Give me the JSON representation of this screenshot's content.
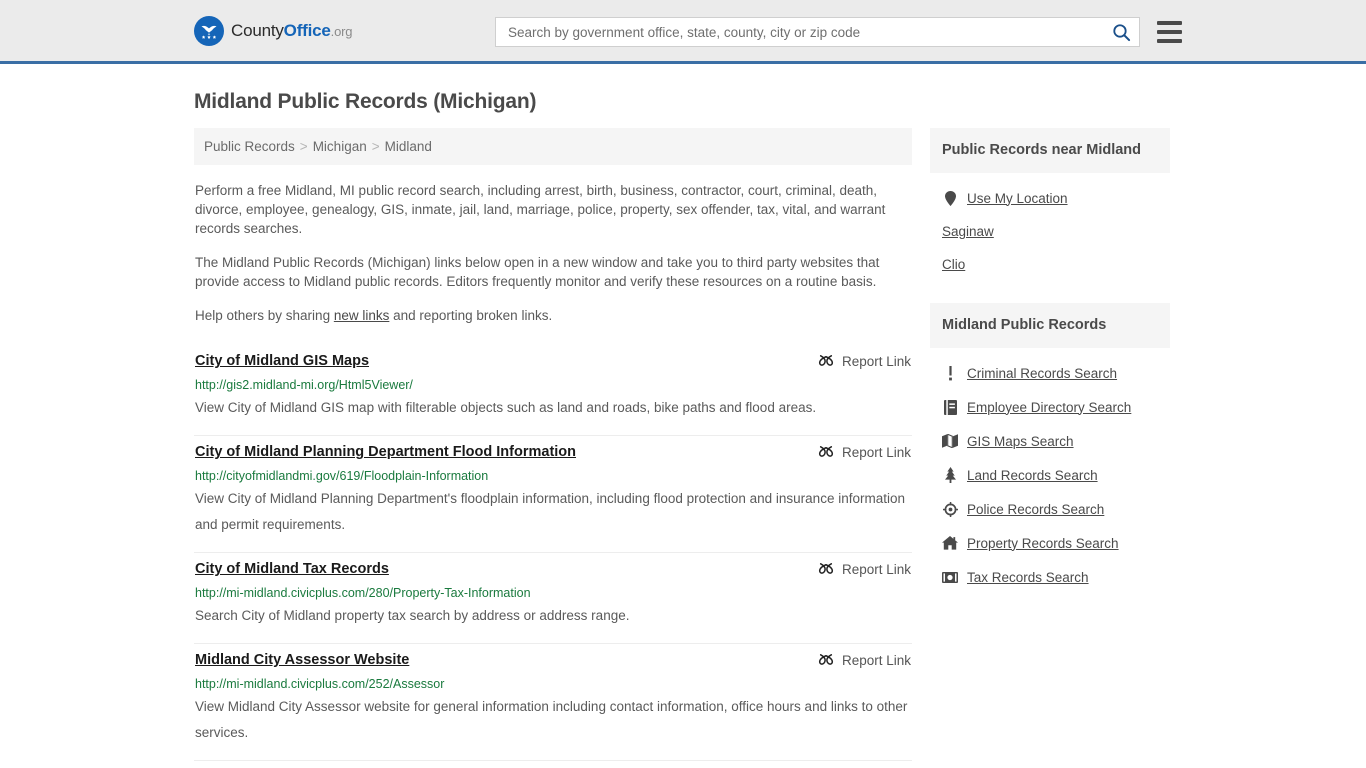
{
  "header": {
    "logo": {
      "part1": "County",
      "part2": "Office",
      "part3": ".org",
      "emblem_color": "#1565b8"
    },
    "search": {
      "placeholder": "Search by government office, state, county, city or zip code",
      "value": ""
    },
    "accent_color": "#3a6ea5",
    "background_color": "#ebebeb"
  },
  "page_title": "Midland Public Records (Michigan)",
  "breadcrumb": {
    "separator": ">",
    "items": [
      {
        "label": "Public Records"
      },
      {
        "label": "Michigan"
      },
      {
        "label": "Midland"
      }
    ]
  },
  "intro": {
    "paragraph1": "Perform a free Midland, MI public record search, including arrest, birth, business, contractor, court, criminal, death, divorce, employee, genealogy, GIS, inmate, jail, land, marriage, police, property, sex offender, tax, vital, and warrant records searches.",
    "paragraph2": "The Midland Public Records (Michigan) links below open in a new window and take you to third party websites that provide access to Midland public records. Editors frequently monitor and verify these resources on a routine basis.",
    "paragraph3_before": "Help others by sharing ",
    "paragraph3_link": "new links",
    "paragraph3_after": " and reporting broken links."
  },
  "report_link_label": "Report Link",
  "results": [
    {
      "title": "City of Midland GIS Maps",
      "url": "http://gis2.midland-mi.org/Html5Viewer/",
      "description": "View City of Midland GIS map with filterable objects such as land and roads, bike paths and flood areas."
    },
    {
      "title": "City of Midland Planning Department Flood Information",
      "url": "http://cityofmidlandmi.gov/619/Floodplain-Information",
      "description": "View City of Midland Planning Department's floodplain information, including flood protection and insurance information and permit requirements."
    },
    {
      "title": "City of Midland Tax Records",
      "url": "http://mi-midland.civicplus.com/280/Property-Tax-Information",
      "description": "Search City of Midland property tax search by address or address range."
    },
    {
      "title": "Midland City Assessor Website",
      "url": "http://mi-midland.civicplus.com/252/Assessor",
      "description": "View Midland City Assessor website for general information including contact information, office hours and links to other services."
    }
  ],
  "sidebar": {
    "near_card": {
      "title": "Public Records near Midland",
      "items": [
        {
          "label": "Use My Location",
          "icon": "map-pin-icon"
        },
        {
          "label": "Saginaw",
          "icon": "none"
        },
        {
          "label": "Clio",
          "icon": "none"
        }
      ]
    },
    "records_card": {
      "title": "Midland Public Records",
      "items": [
        {
          "label": "Criminal Records Search",
          "icon": "exclamation-icon"
        },
        {
          "label": "Employee Directory Search",
          "icon": "book-icon"
        },
        {
          "label": "GIS Maps Search",
          "icon": "map-icon"
        },
        {
          "label": "Land Records Search",
          "icon": "tree-icon"
        },
        {
          "label": "Police Records Search",
          "icon": "badge-icon"
        },
        {
          "label": "Property Records Search",
          "icon": "home-icon"
        },
        {
          "label": "Tax Records Search",
          "icon": "money-icon"
        }
      ]
    }
  },
  "colors": {
    "url_green": "#1a7a3e",
    "link_blue": "#1565b8",
    "card_header_bg": "#f5f5f5",
    "divider": "#ededed"
  }
}
